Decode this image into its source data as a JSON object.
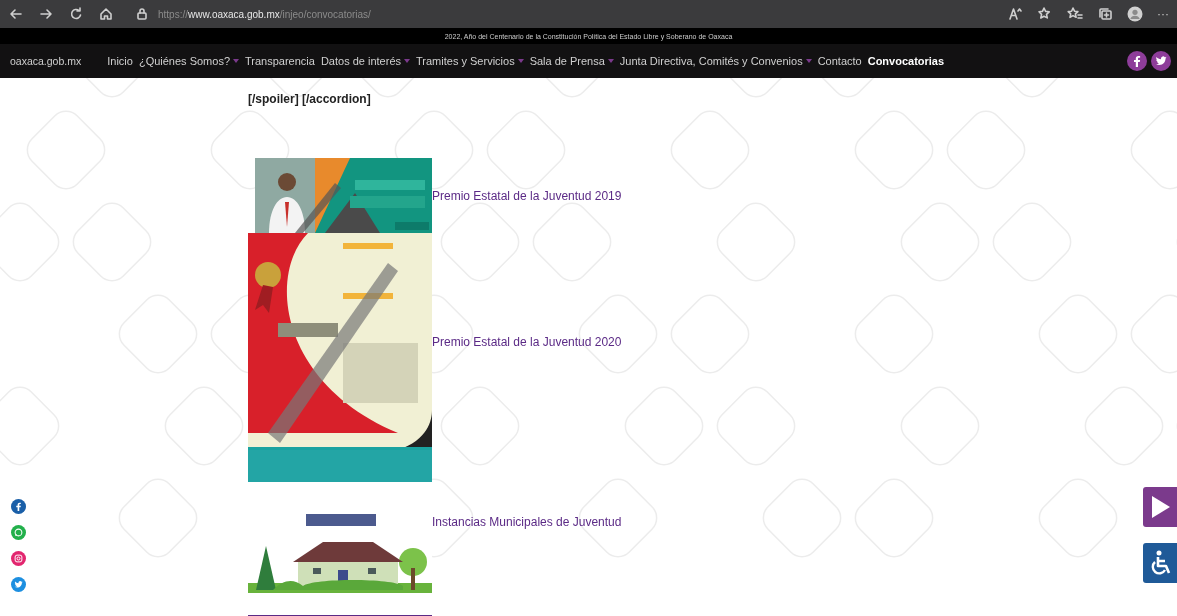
{
  "browser": {
    "url": {
      "scheme": "https://",
      "host": "www.oaxaca.gob.mx",
      "path": "/injeo/convocatorias/"
    },
    "more_label": "···"
  },
  "banner": "2022, Año del Centenario de la Constitución Política del Estado Libre y Soberano de Oaxaca",
  "nav": {
    "brand": "oaxaca.gob.mx",
    "items": [
      {
        "label": "Inicio",
        "dropdown": false,
        "selected": false
      },
      {
        "label": "¿Quiénes Somos?",
        "dropdown": true,
        "selected": false
      },
      {
        "label": "Transparencia",
        "dropdown": false,
        "selected": false
      },
      {
        "label": "Datos de interés",
        "dropdown": true,
        "selected": false
      },
      {
        "label": "Tramites y Servicios",
        "dropdown": true,
        "selected": false
      },
      {
        "label": "Sala de Prensa",
        "dropdown": true,
        "selected": false
      },
      {
        "label": "Junta Directiva, Comités y Convenios",
        "dropdown": true,
        "selected": false
      },
      {
        "label": "Contacto",
        "dropdown": false,
        "selected": false
      },
      {
        "label": "Convocatorias",
        "dropdown": false,
        "selected": true
      }
    ],
    "social": [
      {
        "kind": "facebook"
      },
      {
        "kind": "twitter"
      }
    ]
  },
  "content": {
    "note": "[/spoiler] [/accordion]",
    "items": [
      {
        "image": {
          "kind": "picture"
        },
        "title": "Premio Estatal de la Juventud 2019"
      },
      {
        "image": {
          "kind": "picture"
        },
        "title": "Premio Estatal de la Juventud 2020"
      },
      {
        "image": {
          "kind": "picture"
        },
        "title": "Instancias Municipales de Juventud"
      },
      {
        "image": {
          "kind": "picture"
        }
      }
    ]
  },
  "side_social": [
    {
      "kind": "facebook",
      "color": "#1a5fa8"
    },
    {
      "kind": "whatsapp",
      "color": "#22b04b"
    },
    {
      "kind": "instagram",
      "color": "#e2266f"
    },
    {
      "kind": "twitter",
      "color": "#1d8fe0"
    }
  ]
}
